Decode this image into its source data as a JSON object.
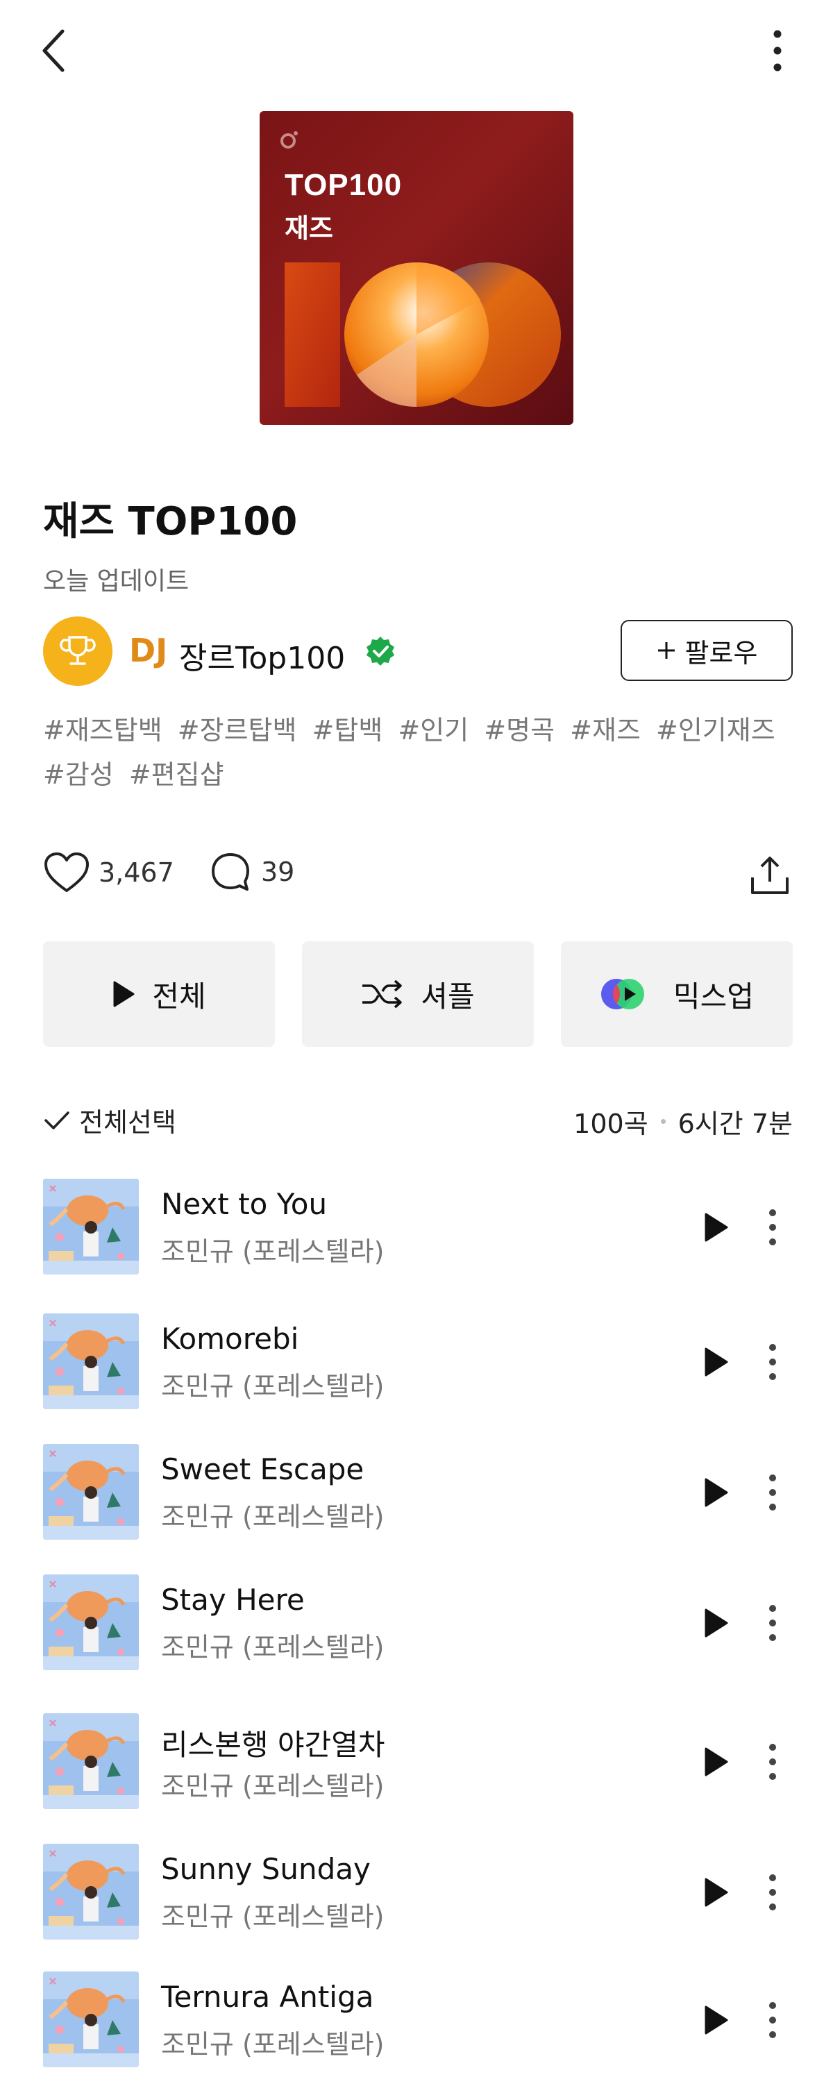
{
  "header": {
    "back_icon": "chevron-left-icon",
    "more_icon": "vertical-dots-icon"
  },
  "cover": {
    "title": "TOP100",
    "subtitle": "재즈",
    "big_text": "100",
    "colors": {
      "bg": "#7a1416",
      "accent": "#ff8c1a"
    }
  },
  "playlist": {
    "title": "재즈 TOP100",
    "updated": "오늘 업데이트"
  },
  "dj": {
    "prefix": "DJ",
    "name": "장르Top100",
    "avatar_icon": "trophy-icon",
    "verified_icon": "verified-badge-icon",
    "follow_label": "팔로우",
    "follow_icon": "plus-icon"
  },
  "tags": [
    "#재즈탑백",
    "#장르탑백",
    "#탑백",
    "#인기",
    "#명곡",
    "#재즈",
    "#인기재즈",
    "#감성",
    "#편집샵"
  ],
  "stats": {
    "likes": "3,467",
    "comments": "39"
  },
  "actions": {
    "play_all": "전체",
    "shuffle": "셔플",
    "mixup": "믹스업"
  },
  "list": {
    "select_all": "전체선택",
    "count": "100곡",
    "duration": "6시간 7분"
  },
  "tracks": [
    {
      "title": "Next to You",
      "artist": "조민규 (포레스텔라)"
    },
    {
      "title": "Komorebi",
      "artist": "조민규 (포레스텔라)"
    },
    {
      "title": "Sweet Escape",
      "artist": "조민규 (포레스텔라)"
    },
    {
      "title": "Stay Here",
      "artist": "조민규 (포레스텔라)"
    },
    {
      "title": "리스본행 야간열차",
      "artist": "조민규 (포레스텔라)"
    },
    {
      "title": "Sunny Sunday",
      "artist": "조민규 (포레스텔라)"
    },
    {
      "title": "Ternura Antiga",
      "artist": "조민규 (포레스텔라)"
    }
  ]
}
